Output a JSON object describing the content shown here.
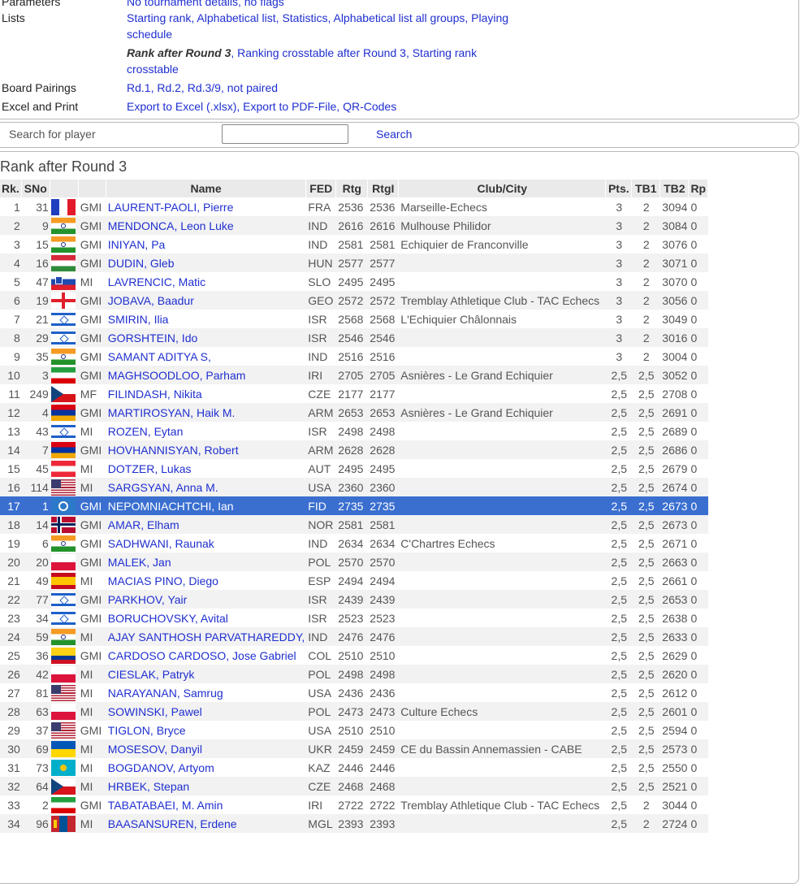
{
  "info": {
    "parameters_label": "Parameters",
    "parameters_value": "No tournament details, no flags",
    "lists_label": "Lists",
    "lists_line1": [
      "Starting rank",
      "Alphabetical list",
      "Statistics",
      "Alphabetical list all groups",
      "Playing schedule"
    ],
    "lists_line2_current": "Rank after Round 3",
    "lists_line2": [
      "Ranking crosstable after Round 3",
      "Starting rank crosstable"
    ],
    "pairings_label": "Board Pairings",
    "pairings": [
      "Rd.1",
      "Rd.2",
      "Rd.3/9"
    ],
    "pairings_suffix": ", not paired",
    "export_label": "Excel and Print",
    "export": [
      "Export to Excel (.xlsx)",
      "Export to PDF-File",
      "QR-Codes"
    ]
  },
  "search": {
    "label": "Search for player",
    "value": "",
    "button": "Search"
  },
  "section_title": "Rank after Round 3",
  "columns": [
    "Rk.",
    "SNo",
    "",
    "",
    "Name",
    "FED",
    "Rtg",
    "RtgI",
    "Club/City",
    "Pts.",
    "TB1",
    "TB2",
    "Rp"
  ],
  "colors": {
    "link": "#1f2fd0",
    "selected": "#3a6fd0"
  },
  "selected_row": 16,
  "rows": [
    {
      "rk": "1",
      "sno": "31",
      "flag": "fr",
      "title": "GMI",
      "name": "LAURENT-PAOLI, Pierre",
      "fed": "FRA",
      "rtg": "2536",
      "rtgi": "2536",
      "club": "Marseille-Echecs",
      "pts": "3",
      "tb1": "2",
      "tb2": "3094",
      "rp": "0"
    },
    {
      "rk": "2",
      "sno": "9",
      "flag": "in",
      "title": "GMI",
      "name": "MENDONCA, Leon Luke",
      "fed": "IND",
      "rtg": "2616",
      "rtgi": "2616",
      "club": "Mulhouse Philidor",
      "pts": "3",
      "tb1": "2",
      "tb2": "3084",
      "rp": "0"
    },
    {
      "rk": "3",
      "sno": "15",
      "flag": "in",
      "title": "GMI",
      "name": "INIYAN, Pa",
      "fed": "IND",
      "rtg": "2581",
      "rtgi": "2581",
      "club": "Echiquier de Franconville",
      "pts": "3",
      "tb1": "2",
      "tb2": "3076",
      "rp": "0"
    },
    {
      "rk": "4",
      "sno": "16",
      "flag": "hu",
      "title": "GMI",
      "name": "DUDIN, Gleb",
      "fed": "HUN",
      "rtg": "2577",
      "rtgi": "2577",
      "club": "",
      "pts": "3",
      "tb1": "2",
      "tb2": "3071",
      "rp": "0"
    },
    {
      "rk": "5",
      "sno": "47",
      "flag": "si",
      "title": "MI",
      "name": "LAVRENCIC, Matic",
      "fed": "SLO",
      "rtg": "2495",
      "rtgi": "2495",
      "club": "",
      "pts": "3",
      "tb1": "2",
      "tb2": "3070",
      "rp": "0"
    },
    {
      "rk": "6",
      "sno": "19",
      "flag": "ge",
      "title": "GMI",
      "name": "JOBAVA, Baadur",
      "fed": "GEO",
      "rtg": "2572",
      "rtgi": "2572",
      "club": "Tremblay Athletique Club - TAC Echecs",
      "pts": "3",
      "tb1": "2",
      "tb2": "3056",
      "rp": "0"
    },
    {
      "rk": "7",
      "sno": "21",
      "flag": "il",
      "title": "GMI",
      "name": "SMIRIN, Ilia",
      "fed": "ISR",
      "rtg": "2568",
      "rtgi": "2568",
      "club": "L'Echiquier Châlonnais",
      "pts": "3",
      "tb1": "2",
      "tb2": "3049",
      "rp": "0"
    },
    {
      "rk": "8",
      "sno": "29",
      "flag": "il",
      "title": "GMI",
      "name": "GORSHTEIN, Ido",
      "fed": "ISR",
      "rtg": "2546",
      "rtgi": "2546",
      "club": "",
      "pts": "3",
      "tb1": "2",
      "tb2": "3016",
      "rp": "0"
    },
    {
      "rk": "9",
      "sno": "35",
      "flag": "in",
      "title": "GMI",
      "name": "SAMANT ADITYA S,",
      "fed": "IND",
      "rtg": "2516",
      "rtgi": "2516",
      "club": "",
      "pts": "3",
      "tb1": "2",
      "tb2": "3004",
      "rp": "0"
    },
    {
      "rk": "10",
      "sno": "3",
      "flag": "ir",
      "title": "GMI",
      "name": "MAGHSOODLOO, Parham",
      "fed": "IRI",
      "rtg": "2705",
      "rtgi": "2705",
      "club": "Asnières - Le Grand Echiquier",
      "pts": "2,5",
      "tb1": "2,5",
      "tb2": "3052",
      "rp": "0"
    },
    {
      "rk": "11",
      "sno": "249",
      "flag": "cz",
      "title": "MF",
      "name": "FILINDASH, Nikita",
      "fed": "CZE",
      "rtg": "2177",
      "rtgi": "2177",
      "club": "",
      "pts": "2,5",
      "tb1": "2,5",
      "tb2": "2708",
      "rp": "0"
    },
    {
      "rk": "12",
      "sno": "4",
      "flag": "am",
      "title": "GMI",
      "name": "MARTIROSYAN, Haik M.",
      "fed": "ARM",
      "rtg": "2653",
      "rtgi": "2653",
      "club": "Asnières - Le Grand Echiquier",
      "pts": "2,5",
      "tb1": "2,5",
      "tb2": "2691",
      "rp": "0"
    },
    {
      "rk": "13",
      "sno": "43",
      "flag": "il",
      "title": "MI",
      "name": "ROZEN, Eytan",
      "fed": "ISR",
      "rtg": "2498",
      "rtgi": "2498",
      "club": "",
      "pts": "2,5",
      "tb1": "2,5",
      "tb2": "2689",
      "rp": "0"
    },
    {
      "rk": "14",
      "sno": "7",
      "flag": "am",
      "title": "GMI",
      "name": "HOVHANNISYAN, Robert",
      "fed": "ARM",
      "rtg": "2628",
      "rtgi": "2628",
      "club": "",
      "pts": "2,5",
      "tb1": "2,5",
      "tb2": "2686",
      "rp": "0"
    },
    {
      "rk": "15",
      "sno": "45",
      "flag": "at",
      "title": "MI",
      "name": "DOTZER, Lukas",
      "fed": "AUT",
      "rtg": "2495",
      "rtgi": "2495",
      "club": "",
      "pts": "2,5",
      "tb1": "2,5",
      "tb2": "2679",
      "rp": "0"
    },
    {
      "rk": "16",
      "sno": "114",
      "flag": "us",
      "title": "MI",
      "name": "SARGSYAN, Anna M.",
      "fed": "USA",
      "rtg": "2360",
      "rtgi": "2360",
      "club": "",
      "pts": "2,5",
      "tb1": "2,5",
      "tb2": "2674",
      "rp": "0"
    },
    {
      "rk": "17",
      "sno": "1",
      "flag": "fide",
      "title": "GMI",
      "name": "NEPOMNIACHTCHI, Ian",
      "fed": "FID",
      "rtg": "2735",
      "rtgi": "2735",
      "club": "",
      "pts": "2,5",
      "tb1": "2,5",
      "tb2": "2673",
      "rp": "0"
    },
    {
      "rk": "18",
      "sno": "14",
      "flag": "no",
      "title": "GMI",
      "name": "AMAR, Elham",
      "fed": "NOR",
      "rtg": "2581",
      "rtgi": "2581",
      "club": "",
      "pts": "2,5",
      "tb1": "2,5",
      "tb2": "2673",
      "rp": "0"
    },
    {
      "rk": "19",
      "sno": "6",
      "flag": "in",
      "title": "GMI",
      "name": "SADHWANI, Raunak",
      "fed": "IND",
      "rtg": "2634",
      "rtgi": "2634",
      "club": "C'Chartres Echecs",
      "pts": "2,5",
      "tb1": "2,5",
      "tb2": "2671",
      "rp": "0"
    },
    {
      "rk": "20",
      "sno": "20",
      "flag": "pl",
      "title": "GMI",
      "name": "MALEK, Jan",
      "fed": "POL",
      "rtg": "2570",
      "rtgi": "2570",
      "club": "",
      "pts": "2,5",
      "tb1": "2,5",
      "tb2": "2663",
      "rp": "0"
    },
    {
      "rk": "21",
      "sno": "49",
      "flag": "es",
      "title": "MI",
      "name": "MACIAS PINO, Diego",
      "fed": "ESP",
      "rtg": "2494",
      "rtgi": "2494",
      "club": "",
      "pts": "2,5",
      "tb1": "2,5",
      "tb2": "2661",
      "rp": "0"
    },
    {
      "rk": "22",
      "sno": "77",
      "flag": "il",
      "title": "GMI",
      "name": "PARKHOV, Yair",
      "fed": "ISR",
      "rtg": "2439",
      "rtgi": "2439",
      "club": "",
      "pts": "2,5",
      "tb1": "2,5",
      "tb2": "2653",
      "rp": "0"
    },
    {
      "rk": "23",
      "sno": "34",
      "flag": "il",
      "title": "GMI",
      "name": "BORUCHOVSKY, Avital",
      "fed": "ISR",
      "rtg": "2523",
      "rtgi": "2523",
      "club": "",
      "pts": "2,5",
      "tb1": "2,5",
      "tb2": "2638",
      "rp": "0"
    },
    {
      "rk": "24",
      "sno": "59",
      "flag": "in",
      "title": "MI",
      "name": "AJAY SANTHOSH PARVATHAREDDY,",
      "fed": "IND",
      "rtg": "2476",
      "rtgi": "2476",
      "club": "",
      "pts": "2,5",
      "tb1": "2,5",
      "tb2": "2633",
      "rp": "0"
    },
    {
      "rk": "25",
      "sno": "36",
      "flag": "co",
      "title": "GMI",
      "name": "CARDOSO CARDOSO, Jose Gabriel",
      "fed": "COL",
      "rtg": "2510",
      "rtgi": "2510",
      "club": "",
      "pts": "2,5",
      "tb1": "2,5",
      "tb2": "2629",
      "rp": "0"
    },
    {
      "rk": "26",
      "sno": "42",
      "flag": "pl",
      "title": "MI",
      "name": "CIESLAK, Patryk",
      "fed": "POL",
      "rtg": "2498",
      "rtgi": "2498",
      "club": "",
      "pts": "2,5",
      "tb1": "2,5",
      "tb2": "2620",
      "rp": "0"
    },
    {
      "rk": "27",
      "sno": "81",
      "flag": "us",
      "title": "MI",
      "name": "NARAYANAN, Samrug",
      "fed": "USA",
      "rtg": "2436",
      "rtgi": "2436",
      "club": "",
      "pts": "2,5",
      "tb1": "2,5",
      "tb2": "2612",
      "rp": "0"
    },
    {
      "rk": "28",
      "sno": "63",
      "flag": "pl",
      "title": "MI",
      "name": "SOWINSKI, Pawel",
      "fed": "POL",
      "rtg": "2473",
      "rtgi": "2473",
      "club": "Culture Echecs",
      "pts": "2,5",
      "tb1": "2,5",
      "tb2": "2601",
      "rp": "0"
    },
    {
      "rk": "29",
      "sno": "37",
      "flag": "us",
      "title": "GMI",
      "name": "TIGLON, Bryce",
      "fed": "USA",
      "rtg": "2510",
      "rtgi": "2510",
      "club": "",
      "pts": "2,5",
      "tb1": "2,5",
      "tb2": "2594",
      "rp": "0"
    },
    {
      "rk": "30",
      "sno": "69",
      "flag": "ua",
      "title": "MI",
      "name": "MOSESOV, Danyil",
      "fed": "UKR",
      "rtg": "2459",
      "rtgi": "2459",
      "club": "CE du Bassin Annemassien - CABE",
      "pts": "2,5",
      "tb1": "2,5",
      "tb2": "2573",
      "rp": "0"
    },
    {
      "rk": "31",
      "sno": "73",
      "flag": "kz",
      "title": "MI",
      "name": "BOGDANOV, Artyom",
      "fed": "KAZ",
      "rtg": "2446",
      "rtgi": "2446",
      "club": "",
      "pts": "2,5",
      "tb1": "2,5",
      "tb2": "2550",
      "rp": "0"
    },
    {
      "rk": "32",
      "sno": "64",
      "flag": "cz",
      "title": "MI",
      "name": "HRBEK, Stepan",
      "fed": "CZE",
      "rtg": "2468",
      "rtgi": "2468",
      "club": "",
      "pts": "2,5",
      "tb1": "2,5",
      "tb2": "2521",
      "rp": "0"
    },
    {
      "rk": "33",
      "sno": "2",
      "flag": "ir",
      "title": "GMI",
      "name": "TABATABAEI, M. Amin",
      "fed": "IRI",
      "rtg": "2722",
      "rtgi": "2722",
      "club": "Tremblay Athletique Club - TAC Echecs",
      "pts": "2,5",
      "tb1": "2",
      "tb2": "3044",
      "rp": "0"
    },
    {
      "rk": "34",
      "sno": "96",
      "flag": "mn",
      "title": "MI",
      "name": "BAASANSUREN, Erdene",
      "fed": "MGL",
      "rtg": "2393",
      "rtgi": "2393",
      "club": "",
      "pts": "2,5",
      "tb1": "2",
      "tb2": "2724",
      "rp": "0"
    }
  ]
}
